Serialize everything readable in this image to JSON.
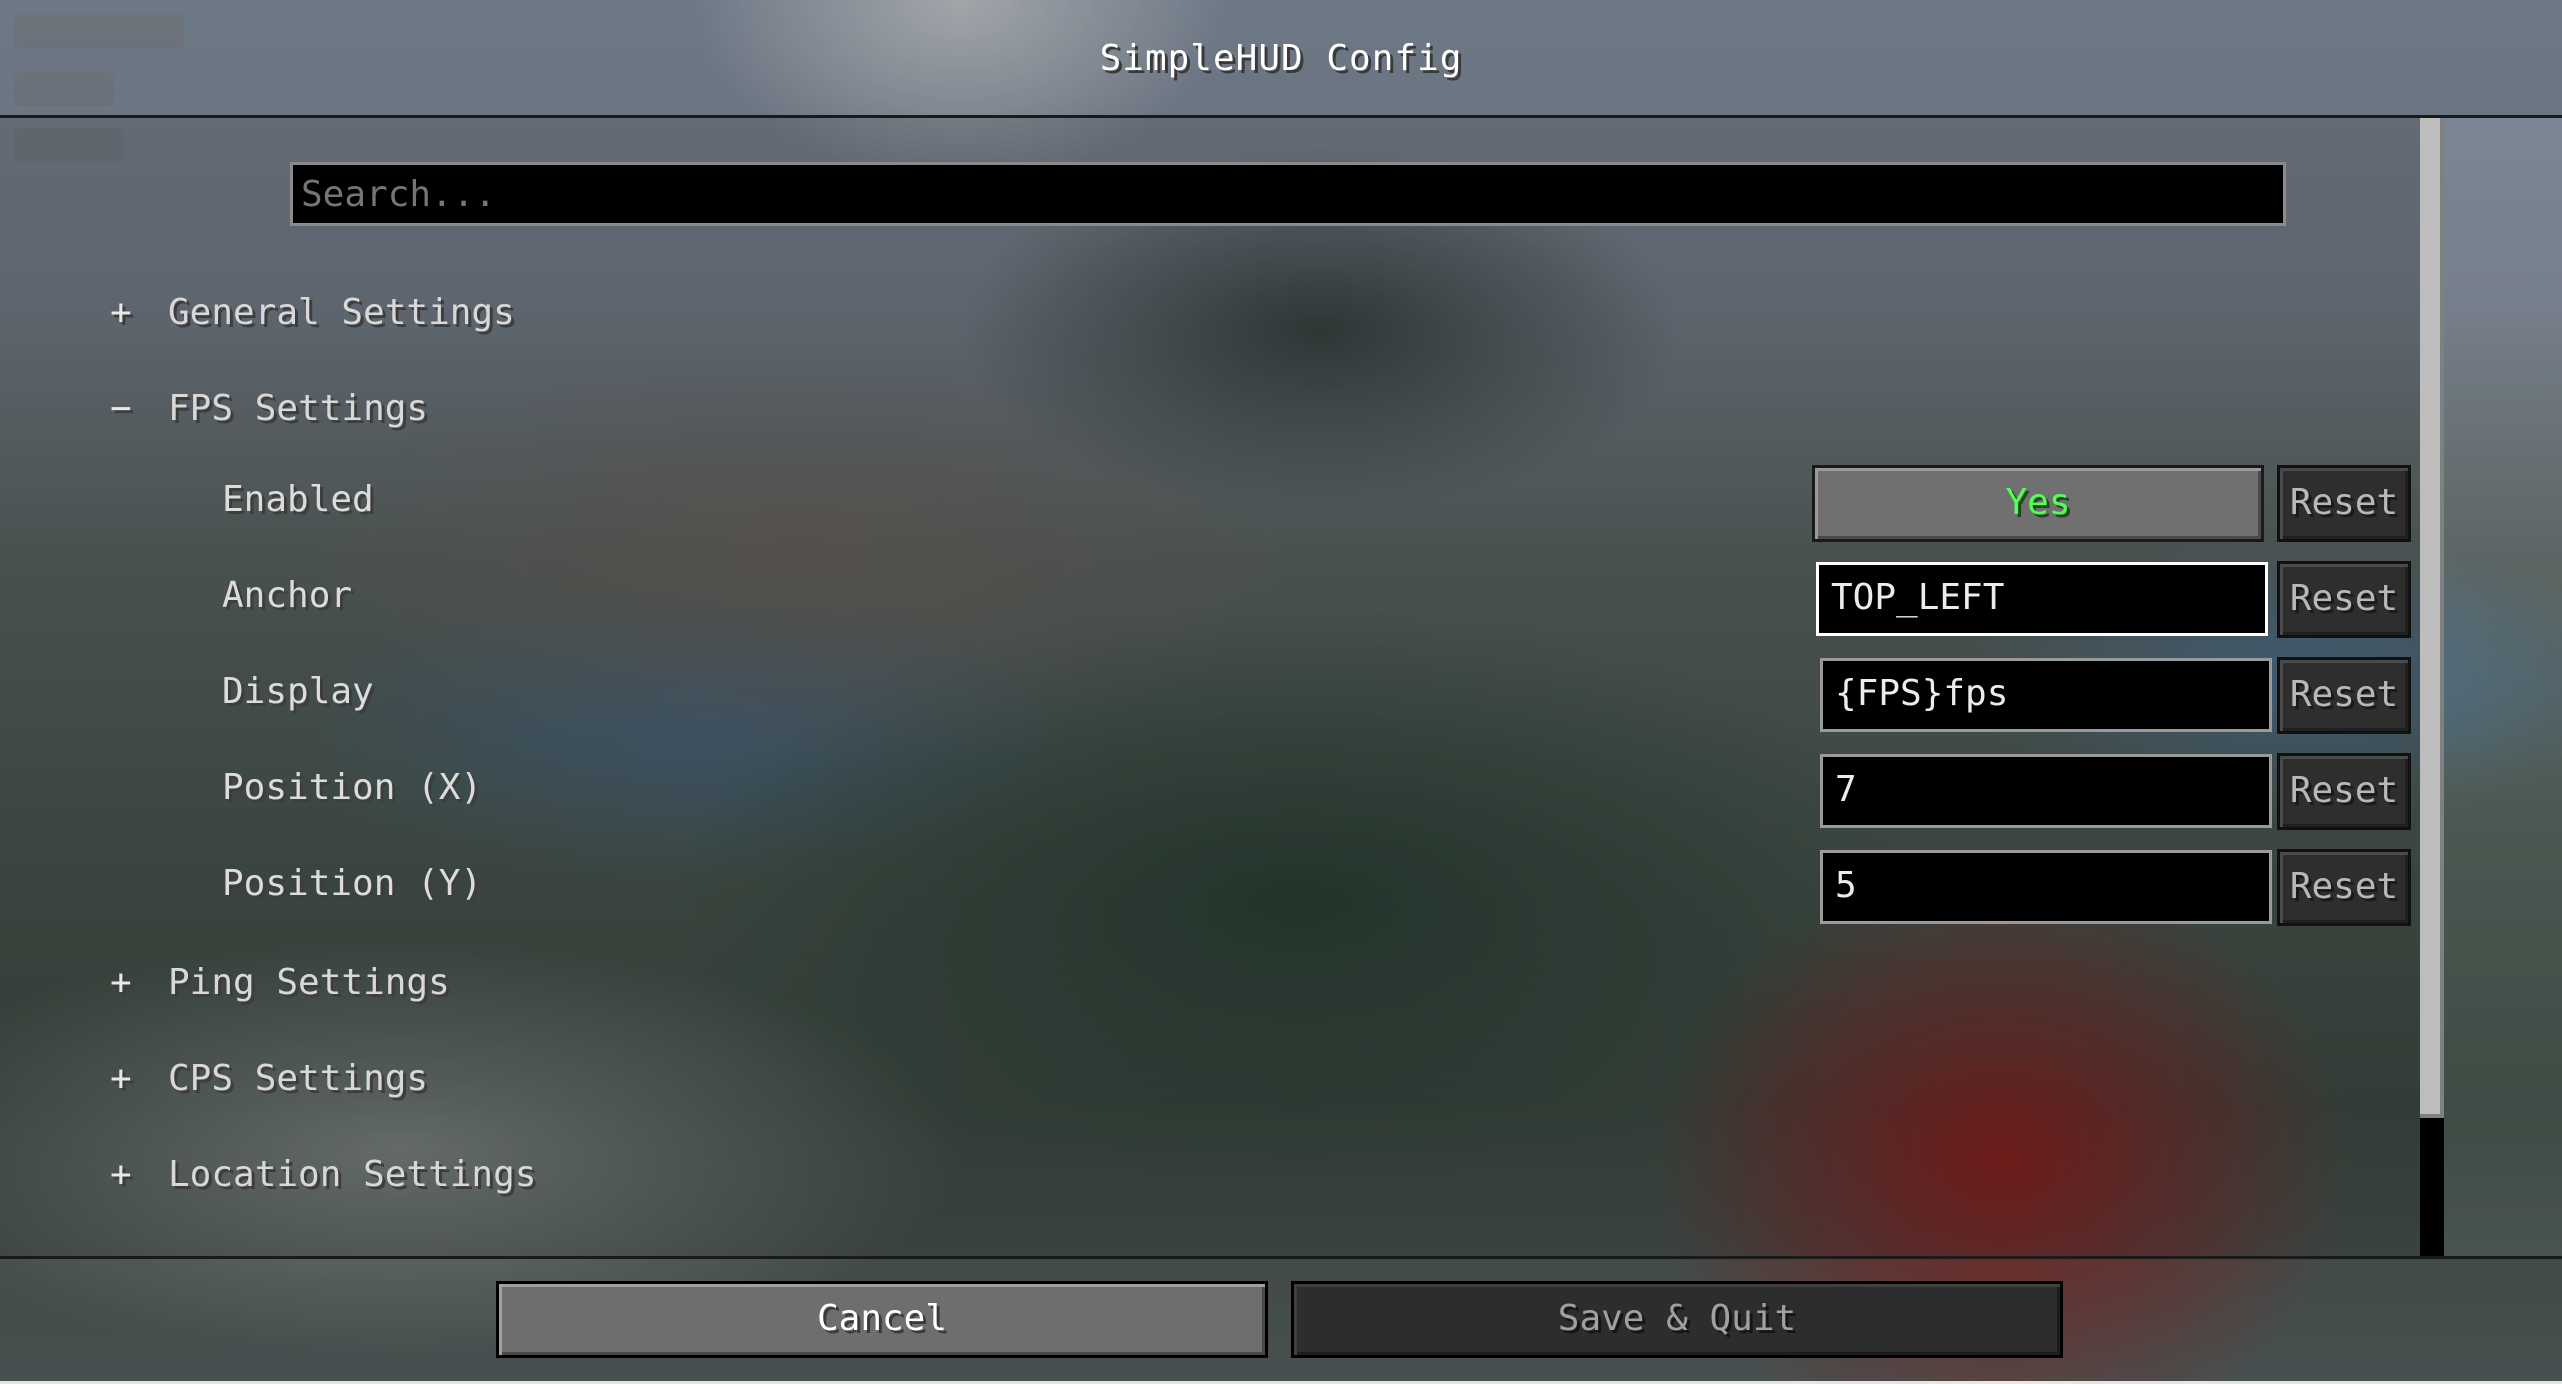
{
  "window": {
    "title": "SimpleHUD Config"
  },
  "search": {
    "placeholder": "Search..."
  },
  "categories": [
    {
      "sign": "+",
      "label": "General Settings",
      "expanded": false
    },
    {
      "sign": "−",
      "label": "FPS Settings",
      "expanded": true
    },
    {
      "sign": "+",
      "label": "Ping Settings",
      "expanded": false
    },
    {
      "sign": "+",
      "label": "CPS Settings",
      "expanded": false
    },
    {
      "sign": "+",
      "label": "Location Settings",
      "expanded": false
    }
  ],
  "fps_options": [
    {
      "label": "Enabled",
      "value": "Yes",
      "reset": "Reset"
    },
    {
      "label": "Anchor",
      "value": "TOP_LEFT",
      "reset": "Reset"
    },
    {
      "label": "Display",
      "value": "{FPS}fps",
      "reset": "Reset"
    },
    {
      "label": "Position (X)",
      "value": "7",
      "reset": "Reset"
    },
    {
      "label": "Position (Y)",
      "value": "5",
      "reset": "Reset"
    }
  ],
  "footer": {
    "cancel": "Cancel",
    "save": "Save & Quit"
  },
  "colors": {
    "enabled_yes": "#55ff55",
    "field_bg": "#000000",
    "reset_bg": "#2e2e2e"
  }
}
